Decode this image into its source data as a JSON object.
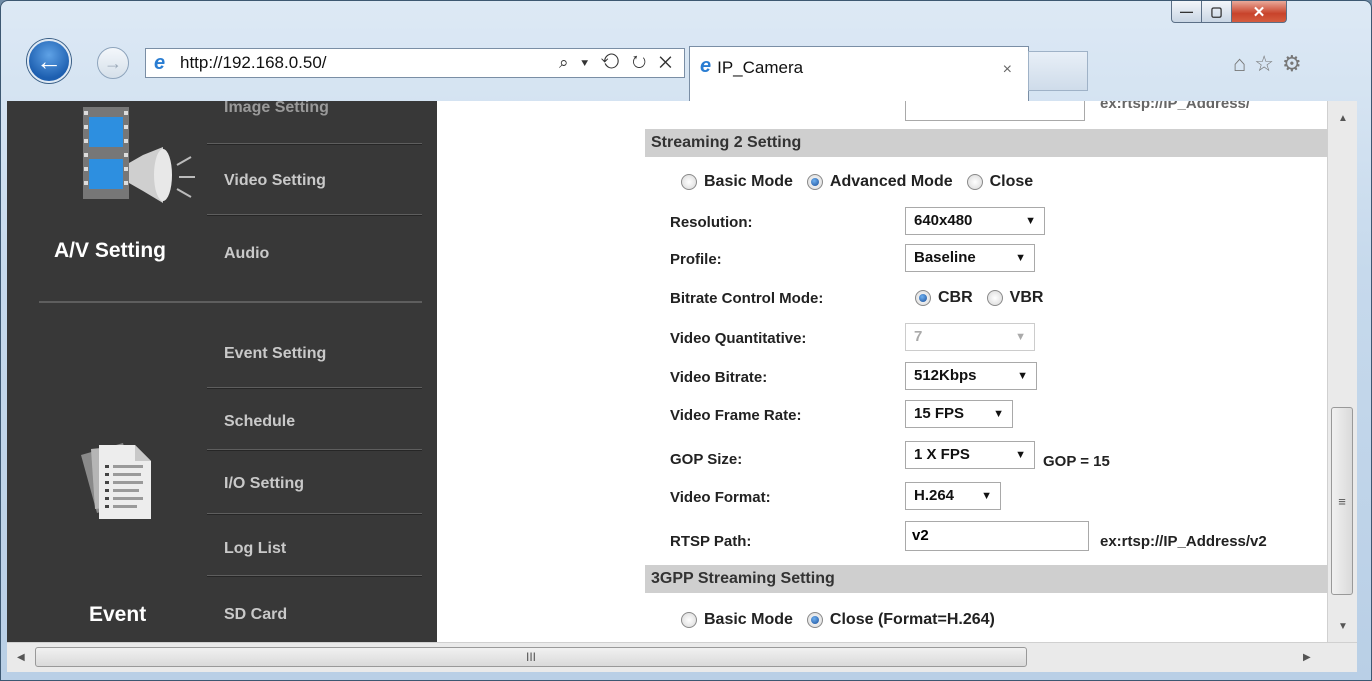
{
  "browser": {
    "url": "http://192.168.0.50/",
    "address_tools": "⌕ ▾ ⟲ ↻ ✕",
    "tab_title": "IP_Camera",
    "tab_close": "×",
    "window_buttons": {
      "minimize": "—",
      "maximize": "▢",
      "close": "✕"
    },
    "toolbar_icons": [
      "home-icon",
      "favorites-icon",
      "settings-icon"
    ]
  },
  "sidebar": {
    "av_group_title": "A/V Setting",
    "event_group_title": "Event",
    "av_items": [
      "Image Setting",
      "Video Setting",
      "Audio"
    ],
    "event_items": [
      "Event Setting",
      "Schedule",
      "I/O Setting",
      "Log List",
      "SD Card"
    ]
  },
  "streaming2": {
    "title": "Streaming 2 Setting",
    "modes": [
      {
        "label": "Basic Mode",
        "selected": false
      },
      {
        "label": "Advanced Mode",
        "selected": true
      },
      {
        "label": "Close",
        "selected": false
      }
    ],
    "fields": {
      "resolution_label": "Resolution:",
      "resolution_value": "640x480",
      "profile_label": "Profile:",
      "profile_value": "Baseline",
      "bitrate_mode_label": "Bitrate Control Mode:",
      "bitrate_modes": [
        {
          "label": "CBR",
          "selected": true
        },
        {
          "label": "VBR",
          "selected": false
        }
      ],
      "quant_label": "Video Quantitative:",
      "quant_value": "7",
      "bitrate_label": "Video Bitrate:",
      "bitrate_value": "512Kbps",
      "framerate_label": "Video Frame Rate:",
      "framerate_value": "15 FPS",
      "gop_label": "GOP Size:",
      "gop_value": "1 X FPS",
      "gop_note": "GOP = 15",
      "format_label": "Video Format:",
      "format_value": "H.264",
      "rtsp_label": "RTSP Path:",
      "rtsp_value": "v2",
      "rtsp_example": "ex:rtsp://IP_Address/v2"
    }
  },
  "gpp": {
    "title": "3GPP Streaming Setting",
    "modes": [
      {
        "label": "Basic Mode",
        "selected": false
      },
      {
        "label": "Close (Format=H.264)",
        "selected": true
      }
    ]
  },
  "top_partial": {
    "example": "ex:rtsp://IP_Address/"
  },
  "scrollbar": {
    "hthumb_grip": "III",
    "vthumb_grip": "≡"
  }
}
